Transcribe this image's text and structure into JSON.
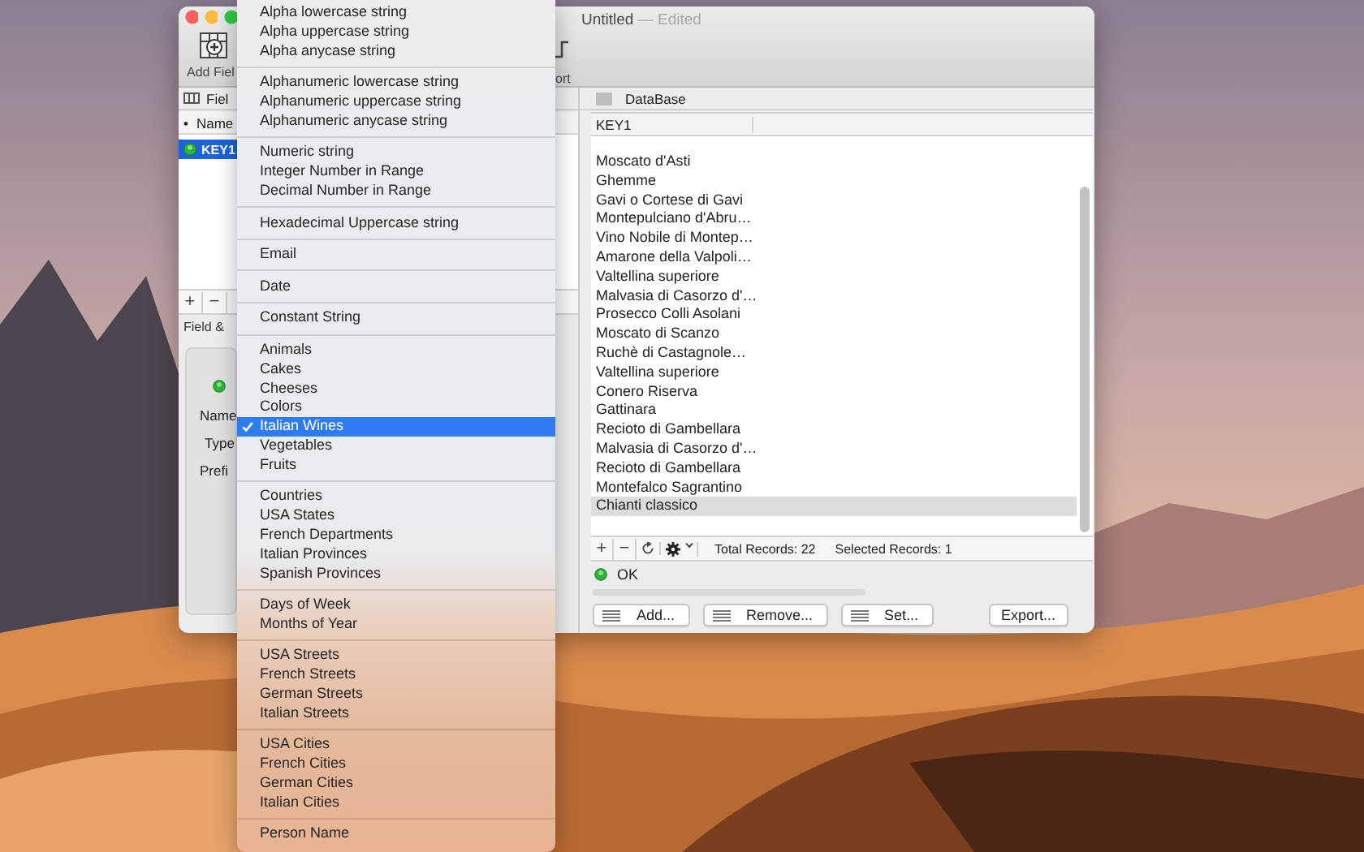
{
  "window": {
    "title": "Untitled",
    "edited": "— Edited"
  },
  "toolbar": [
    {
      "label": "Add Fiel"
    },
    {
      "label": "ort"
    }
  ],
  "fields_pane": {
    "header": "Fiel",
    "columns": [
      "•",
      "Name"
    ],
    "rows": [
      {
        "name": "KEY1",
        "selected": true
      }
    ],
    "buttons": [
      "+",
      "−"
    ],
    "section_title": "Field &",
    "labels": [
      "Name",
      "Type",
      "Prefi"
    ]
  },
  "database": {
    "title": "DataBase",
    "column": "KEY1",
    "rows": [
      {
        "value": "Moscato d'Asti",
        "selected": false
      },
      {
        "value": "Ghemme",
        "selected": false
      },
      {
        "value": "Gavi o Cortese di Gavi",
        "selected": false
      },
      {
        "value": "Montepulciano d'Abru…",
        "selected": false
      },
      {
        "value": "Vino Nobile di Montep…",
        "selected": false
      },
      {
        "value": "Amarone della Valpoli…",
        "selected": false
      },
      {
        "value": "Valtellina superiore",
        "selected": false
      },
      {
        "value": "Malvasia di Casorzo d'…",
        "selected": false
      },
      {
        "value": "Prosecco Colli Asolani",
        "selected": false
      },
      {
        "value": "Moscato di Scanzo",
        "selected": false
      },
      {
        "value": "Ruchè di Castagnole…",
        "selected": false
      },
      {
        "value": "Valtellina superiore",
        "selected": false
      },
      {
        "value": "Conero Riserva",
        "selected": false
      },
      {
        "value": "Gattinara",
        "selected": false
      },
      {
        "value": "Recioto di Gambellara",
        "selected": false
      },
      {
        "value": "Malvasia di Casorzo d'…",
        "selected": false
      },
      {
        "value": "Recioto di Gambellara",
        "selected": false
      },
      {
        "value": "Montefalco Sagrantino",
        "selected": false
      },
      {
        "value": "Chianti classico",
        "selected": true
      }
    ],
    "bar_buttons": [
      "+",
      "−"
    ],
    "total": "Total Records: 22",
    "selected_count": "Selected Records: 1",
    "status": "OK",
    "progress": {
      "level": 0
    },
    "buttons": [
      {
        "label": "Add...",
        "kind": "list"
      },
      {
        "label": "Remove...",
        "kind": "list"
      },
      {
        "label": "Set...",
        "kind": "list"
      },
      {
        "label": "Export...",
        "kind": "plain"
      }
    ]
  },
  "menu": {
    "sections": [
      {
        "items": [
          {
            "label": "Alpha lowercase string",
            "selected": false
          },
          {
            "label": "Alpha uppercase string",
            "selected": false
          },
          {
            "label": "Alpha anycase string",
            "selected": false
          }
        ]
      },
      {
        "items": [
          {
            "label": "Alphanumeric lowercase string",
            "selected": false
          },
          {
            "label": "Alphanumeric uppercase string",
            "selected": false
          },
          {
            "label": "Alphanumeric anycase string",
            "selected": false
          }
        ]
      },
      {
        "items": [
          {
            "label": "Numeric string",
            "selected": false
          },
          {
            "label": "Integer Number in Range",
            "selected": false
          },
          {
            "label": "Decimal Number in Range",
            "selected": false
          }
        ]
      },
      {
        "items": [
          {
            "label": "Hexadecimal Uppercase string",
            "selected": false
          }
        ]
      },
      {
        "items": [
          {
            "label": "Email",
            "selected": false
          }
        ]
      },
      {
        "items": [
          {
            "label": "Date",
            "selected": false
          }
        ]
      },
      {
        "items": [
          {
            "label": "Constant String",
            "selected": false
          }
        ]
      },
      {
        "items": [
          {
            "label": "Animals",
            "selected": false
          },
          {
            "label": "Cakes",
            "selected": false
          },
          {
            "label": "Cheeses",
            "selected": false
          },
          {
            "label": "Colors",
            "selected": false
          },
          {
            "label": "Italian Wines",
            "selected": true
          },
          {
            "label": "Vegetables",
            "selected": false
          },
          {
            "label": "Fruits",
            "selected": false
          }
        ]
      },
      {
        "items": [
          {
            "label": "Countries",
            "selected": false
          },
          {
            "label": "USA States",
            "selected": false
          },
          {
            "label": "French Departments",
            "selected": false
          },
          {
            "label": "Italian Provinces",
            "selected": false
          },
          {
            "label": "Spanish Provinces",
            "selected": false
          }
        ]
      },
      {
        "items": [
          {
            "label": "Days of Week",
            "selected": false
          },
          {
            "label": "Months of Year",
            "selected": false
          }
        ]
      },
      {
        "items": [
          {
            "label": "USA Streets",
            "selected": false
          },
          {
            "label": "French Streets",
            "selected": false
          },
          {
            "label": "German Streets",
            "selected": false
          },
          {
            "label": "Italian Streets",
            "selected": false
          }
        ]
      },
      {
        "items": [
          {
            "label": "USA Cities",
            "selected": false
          },
          {
            "label": "French Cities",
            "selected": false
          },
          {
            "label": "German Cities",
            "selected": false
          },
          {
            "label": "Italian Cities",
            "selected": false
          }
        ]
      },
      {
        "items": [
          {
            "label": "Person Name",
            "selected": false
          }
        ]
      }
    ]
  }
}
